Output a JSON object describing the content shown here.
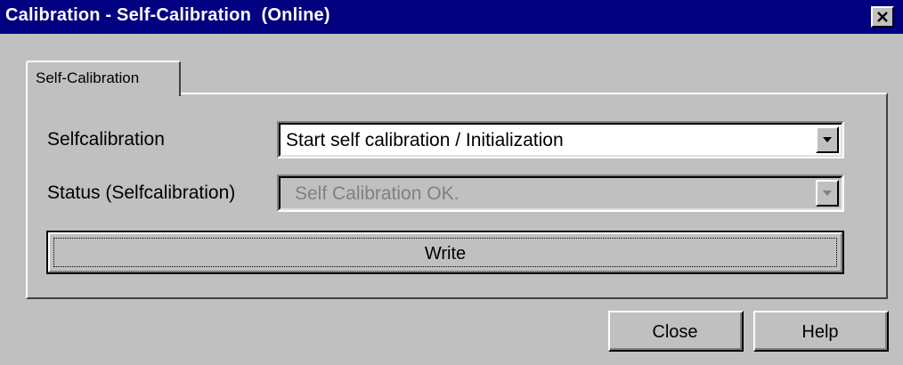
{
  "window": {
    "title": "Calibration - Self-Calibration  (Online)"
  },
  "icons": {
    "close": "close-icon",
    "dropdown": "chevron-down-icon"
  },
  "colors": {
    "titlebar": "#000080",
    "face": "#c0c0c0",
    "disabled_text": "#808080"
  },
  "tabs": [
    {
      "label": "Self-Calibration",
      "selected": true
    }
  ],
  "form": {
    "selfcalibration": {
      "label": "Selfcalibration",
      "value": "Start self calibration / Initialization",
      "enabled": true
    },
    "status": {
      "label": "Status (Selfcalibration)",
      "value": "Self Calibration OK.",
      "enabled": false
    },
    "write_label": "Write"
  },
  "footer": {
    "close_label": "Close",
    "help_label": "Help"
  }
}
